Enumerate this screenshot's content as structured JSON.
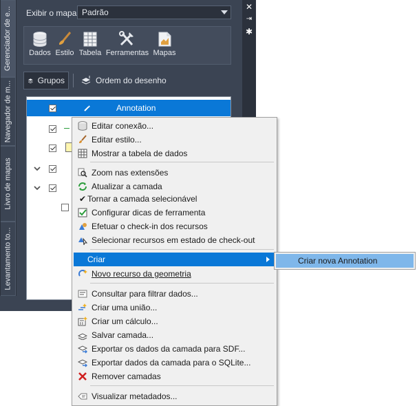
{
  "side_tabs": [
    {
      "label": "Gerenciador de e..."
    },
    {
      "label": "Navegador de m..."
    },
    {
      "label": "Livro de mapas"
    },
    {
      "label": "Levantamento to..."
    }
  ],
  "window_controls": {
    "close_icon": "close-icon",
    "autohide_icon": "autohide-icon",
    "properties_icon": "gear-icon"
  },
  "show_map": {
    "label": "Exibir o mapa:",
    "value": "Padrão"
  },
  "toolbar": {
    "dados": "Dados",
    "estilo": "Estilo",
    "tabela": "Tabela",
    "ferramentas": "Ferramentas",
    "mapas": "Mapas"
  },
  "subbar": {
    "grupos": "Grupos",
    "ordem": "Ordem do desenho"
  },
  "layers": {
    "selected_name": "Annotation"
  },
  "context_menu": {
    "editar_conexao": "Editar conexão...",
    "editar_estilo": "Editar estilo...",
    "mostrar_tabela": "Mostrar a tabela de dados",
    "zoom_extensoes": "Zoom nas extensões",
    "atualizar": "Atualizar a camada",
    "tornar_selecionavel": "Tornar a camada selecionável",
    "configurar_dicas": "Configurar dicas de ferramenta",
    "efetuar_checkin": "Efetuar o check-in dos recursos",
    "selecionar_checkout": "Selecionar recursos em estado de check-out",
    "criar": "Criar",
    "novo_recurso": "Novo recurso da geometria",
    "consultar": "Consultar para filtrar dados...",
    "criar_uniao": "Criar uma união...",
    "criar_calculo": "Criar um cálculo...",
    "salvar_camada": "Salvar camada...",
    "exportar_sdf": "Exportar os dados da camada para SDF...",
    "exportar_sqlite": "Exportar dados da camada para o SQLite...",
    "remover": "Remover camadas",
    "visualizar_metadados": "Visualizar metadados..."
  },
  "submenu": {
    "criar_nova": "Criar nova Annotation"
  },
  "colors": {
    "highlight": "#0a78d7",
    "submenu_highlight": "#7fb7ea",
    "palette_bg": "#3b4453"
  }
}
